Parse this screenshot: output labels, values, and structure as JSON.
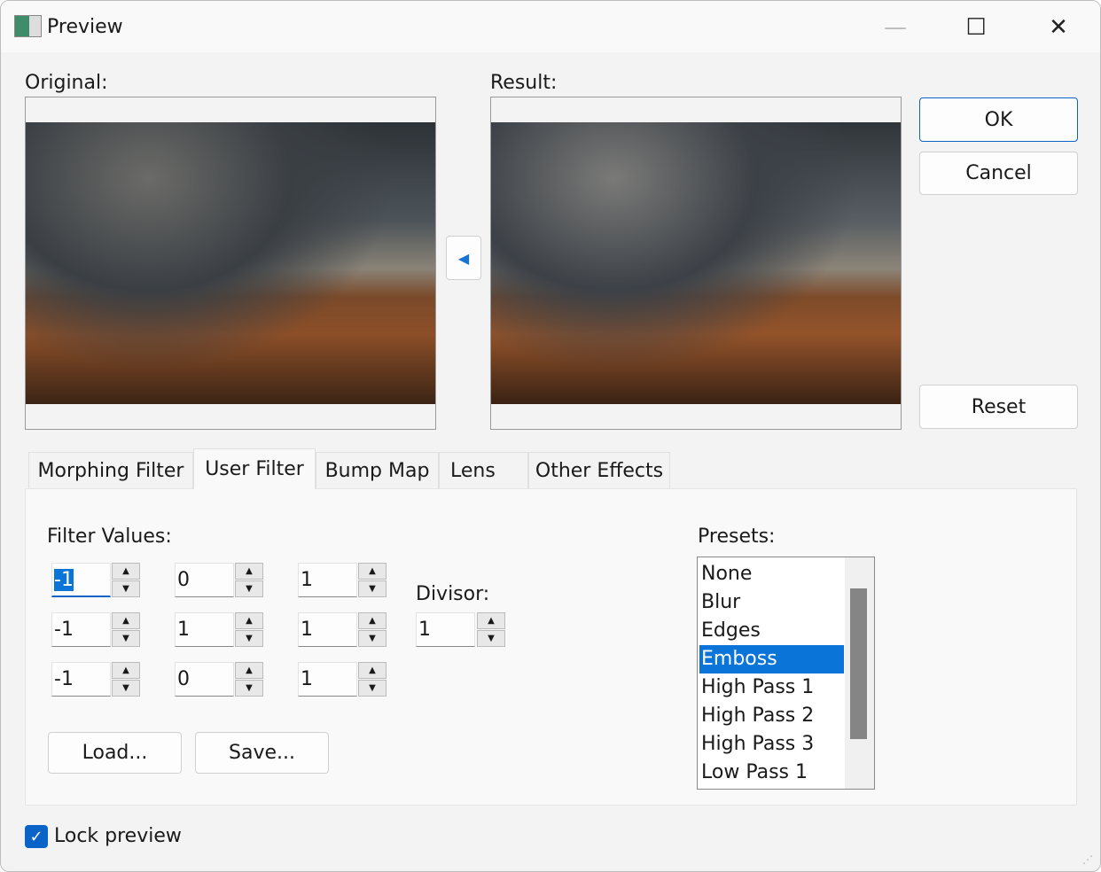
{
  "window": {
    "title": "Preview",
    "icon": "app-icon",
    "minimize_icon": "minimize-icon",
    "maximize_icon": "maximize-icon",
    "close_icon": "close-icon"
  },
  "preview": {
    "original_label": "Original:",
    "result_label": "Result:",
    "arrow_icon": "arrow-left-icon"
  },
  "buttons": {
    "ok": "OK",
    "cancel": "Cancel",
    "reset": "Reset",
    "load": "Load...",
    "save": "Save..."
  },
  "tabs": [
    {
      "label": "Morphing Filter"
    },
    {
      "label": "User Filter",
      "selected": true
    },
    {
      "label": "Bump Map"
    },
    {
      "label": "Lens"
    },
    {
      "label": "Other Effects"
    }
  ],
  "filter": {
    "label": "Filter Values:",
    "values": [
      [
        "-1",
        "0",
        "1"
      ],
      [
        "-1",
        "1",
        "1"
      ],
      [
        "-1",
        "0",
        "1"
      ]
    ],
    "divisor_label": "Divisor:",
    "divisor": "1"
  },
  "presets": {
    "label": "Presets:",
    "items": [
      "None",
      "Blur",
      "Edges",
      "Emboss",
      "High Pass 1",
      "High Pass 2",
      "High Pass 3",
      "Low Pass 1"
    ],
    "selected": "Emboss"
  },
  "lock_preview": {
    "label": "Lock preview",
    "checked": true
  },
  "colors": {
    "accent": "#0a74d8"
  }
}
